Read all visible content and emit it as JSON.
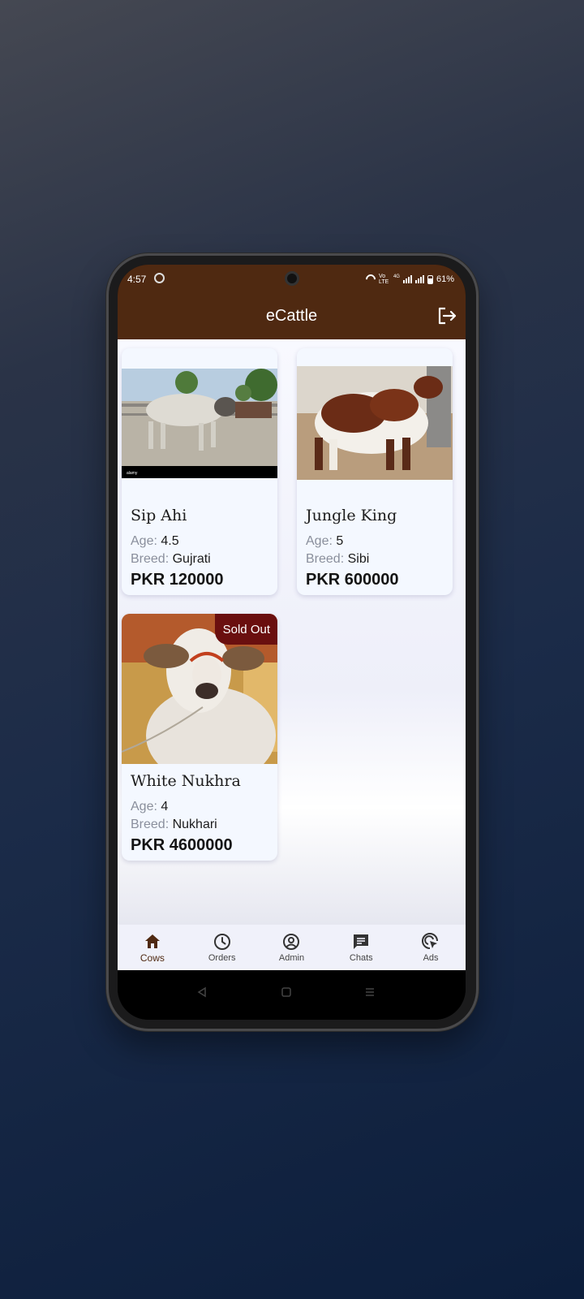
{
  "status_bar": {
    "time": "4:57",
    "network": "Vo LTE",
    "network_gen": "4G",
    "battery": "61%"
  },
  "app": {
    "title": "eCattle"
  },
  "cards": [
    {
      "name": "Sip Ahi",
      "age_label": "Age:",
      "age": "4.5",
      "breed_label": "Breed:",
      "breed": "Gujrati",
      "price": "PKR 120000",
      "sold_out": false
    },
    {
      "name": "Jungle King",
      "age_label": "Age:",
      "age": "5",
      "breed_label": "Breed:",
      "breed": "Sibi",
      "price": "PKR 600000",
      "sold_out": false
    },
    {
      "name": "White Nukhra",
      "age_label": "Age:",
      "age": "4",
      "breed_label": "Breed:",
      "breed": "Nukhari",
      "price": "PKR 4600000",
      "sold_out": true,
      "badge": "Sold Out"
    }
  ],
  "bottom_nav": [
    {
      "label": "Cows",
      "icon": "home-icon",
      "active": true
    },
    {
      "label": "Orders",
      "icon": "clock-icon",
      "active": false
    },
    {
      "label": "Admin",
      "icon": "account-circle-icon",
      "active": false
    },
    {
      "label": "Chats",
      "icon": "chat-icon",
      "active": false
    },
    {
      "label": "Ads",
      "icon": "ads-click-icon",
      "active": false
    }
  ],
  "colors": {
    "primary": "#4f2911",
    "sold_badge": "#6a0f0f",
    "background": "#1b2b48"
  }
}
